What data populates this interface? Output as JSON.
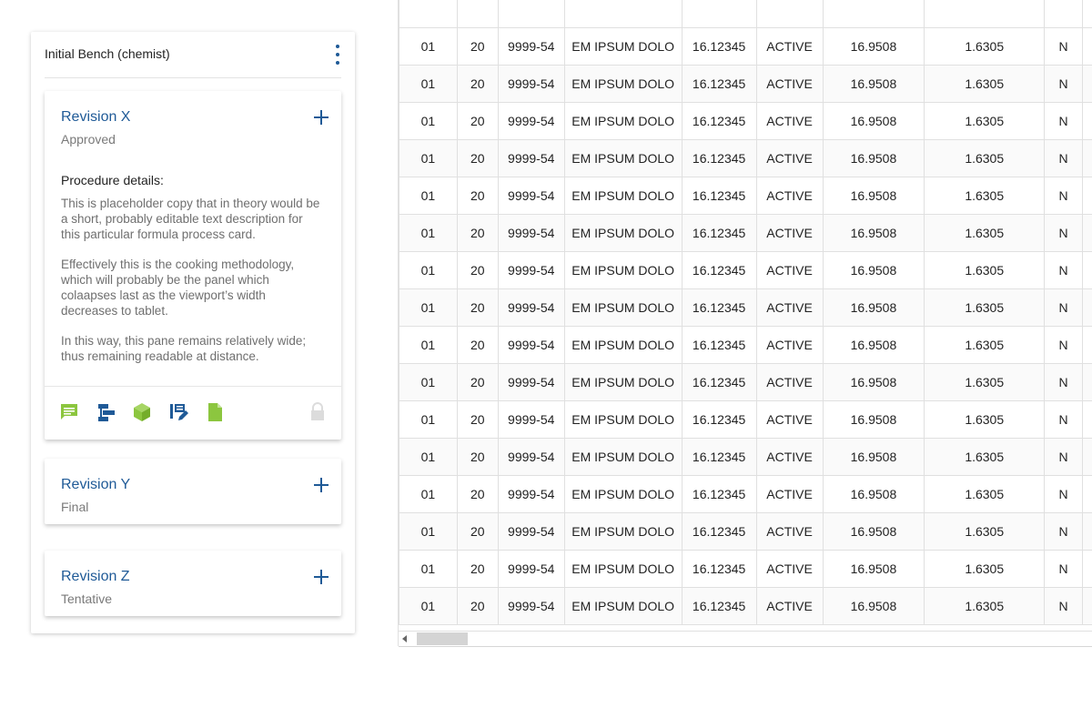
{
  "panel": {
    "title": "Initial Bench (chemist)"
  },
  "revisions": [
    {
      "title": "Revision X",
      "status": "Approved",
      "details_label": "Procedure details:",
      "paragraphs": [
        "This is placeholder copy that in theory would be a short, probably editable text description for this particular formula process card.",
        "Effectively this is the cooking methodology, which will probably be the panel which colaapses last as the viewport’s width decreases to tablet.",
        "In this way, this pane remains relatively wide; thus remaining readable at distance."
      ],
      "toolbar_icons": [
        "comment-icon",
        "workflow-icon",
        "package-cube-icon",
        "edit-list-icon",
        "document-icon"
      ],
      "lock_icon": "lock-icon"
    },
    {
      "title": "Revision Y",
      "status": "Final"
    },
    {
      "title": "Revision Z",
      "status": "Tentative"
    }
  ],
  "table": {
    "rows": [
      [
        "01",
        "20",
        "9999-54",
        "EM IPSUM DOLO",
        "16.12345",
        "ACTIVE",
        "16.9508",
        "1.6305",
        "N"
      ],
      [
        "01",
        "20",
        "9999-54",
        "EM IPSUM DOLO",
        "16.12345",
        "ACTIVE",
        "16.9508",
        "1.6305",
        "N"
      ],
      [
        "01",
        "20",
        "9999-54",
        "EM IPSUM DOLO",
        "16.12345",
        "ACTIVE",
        "16.9508",
        "1.6305",
        "N"
      ],
      [
        "01",
        "20",
        "9999-54",
        "EM IPSUM DOLO",
        "16.12345",
        "ACTIVE",
        "16.9508",
        "1.6305",
        "N"
      ],
      [
        "01",
        "20",
        "9999-54",
        "EM IPSUM DOLO",
        "16.12345",
        "ACTIVE",
        "16.9508",
        "1.6305",
        "N"
      ],
      [
        "01",
        "20",
        "9999-54",
        "EM IPSUM DOLO",
        "16.12345",
        "ACTIVE",
        "16.9508",
        "1.6305",
        "N"
      ],
      [
        "01",
        "20",
        "9999-54",
        "EM IPSUM DOLO",
        "16.12345",
        "ACTIVE",
        "16.9508",
        "1.6305",
        "N"
      ],
      [
        "01",
        "20",
        "9999-54",
        "EM IPSUM DOLO",
        "16.12345",
        "ACTIVE",
        "16.9508",
        "1.6305",
        "N"
      ],
      [
        "01",
        "20",
        "9999-54",
        "EM IPSUM DOLO",
        "16.12345",
        "ACTIVE",
        "16.9508",
        "1.6305",
        "N"
      ],
      [
        "01",
        "20",
        "9999-54",
        "EM IPSUM DOLO",
        "16.12345",
        "ACTIVE",
        "16.9508",
        "1.6305",
        "N"
      ],
      [
        "01",
        "20",
        "9999-54",
        "EM IPSUM DOLO",
        "16.12345",
        "ACTIVE",
        "16.9508",
        "1.6305",
        "N"
      ],
      [
        "01",
        "20",
        "9999-54",
        "EM IPSUM DOLO",
        "16.12345",
        "ACTIVE",
        "16.9508",
        "1.6305",
        "N"
      ],
      [
        "01",
        "20",
        "9999-54",
        "EM IPSUM DOLO",
        "16.12345",
        "ACTIVE",
        "16.9508",
        "1.6305",
        "N"
      ],
      [
        "01",
        "20",
        "9999-54",
        "EM IPSUM DOLO",
        "16.12345",
        "ACTIVE",
        "16.9508",
        "1.6305",
        "N"
      ],
      [
        "01",
        "20",
        "9999-54",
        "EM IPSUM DOLO",
        "16.12345",
        "ACTIVE",
        "16.9508",
        "1.6305",
        "N"
      ],
      [
        "01",
        "20",
        "9999-54",
        "EM IPSUM DOLO",
        "16.12345",
        "ACTIVE",
        "16.9508",
        "1.6305",
        "N"
      ]
    ]
  },
  "colors": {
    "accent_blue": "#1f5a97",
    "accent_green": "#8cc63f",
    "muted_text": "#7a7a7a"
  }
}
